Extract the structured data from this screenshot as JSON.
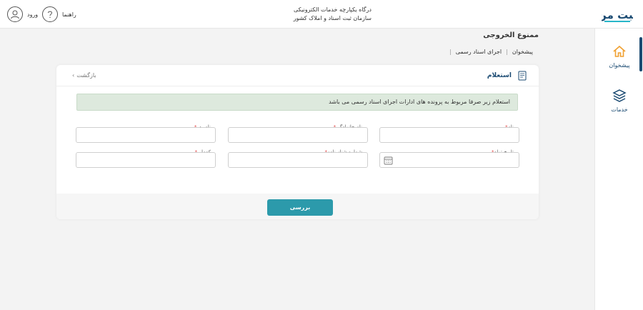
{
  "header": {
    "org_line1": "درگاه یکپارچه خدمات الکترونیکی",
    "org_line2": "سازمان ثبت اسناد و املاک کشور",
    "login_label": "ورود",
    "help_label": "راهنما",
    "logo_text": "ثبت من"
  },
  "sidebar": {
    "items": [
      {
        "label": "پیشخوان",
        "icon": "home-icon",
        "active": true
      },
      {
        "label": "خدمات",
        "icon": "layers-icon",
        "active": false
      }
    ]
  },
  "page": {
    "title": "ممنوع الخروجی",
    "breadcrumb": [
      "پیشخوان",
      "اجرای اسناد رسمی"
    ]
  },
  "card": {
    "title": "استعلام",
    "back_label": "بازگشت",
    "notice": "استعلام زیر صرفا مربوط به پرونده های ادارات اجرای اسناد رسمی می باشد",
    "fields": {
      "first_name": "نام",
      "last_name": "نام خانوادگی",
      "father_name": "نام پدر",
      "birth_date": "تاریخ تولد",
      "id_number": "شماره شناسنامه",
      "national_code": "کدملی"
    },
    "submit_label": "بررسی"
  },
  "colors": {
    "primary": "#1a4a72",
    "button": "#2c9aab",
    "notice_bg": "#dde9dd",
    "required": "#e24a4a"
  }
}
